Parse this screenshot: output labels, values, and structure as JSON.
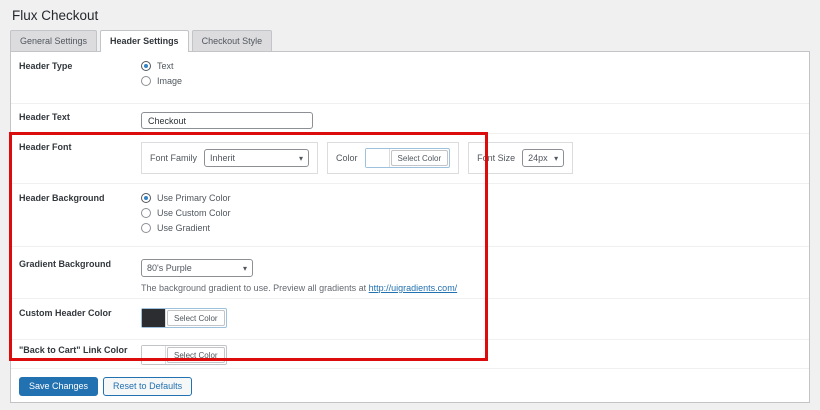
{
  "page": {
    "title": "Flux Checkout"
  },
  "tabs": [
    {
      "label": "General Settings",
      "active": false
    },
    {
      "label": "Header Settings",
      "active": true
    },
    {
      "label": "Checkout Style",
      "active": false
    }
  ],
  "icons": {
    "chevron_down": "▾"
  },
  "rows": {
    "header_type": {
      "label": "Header Type",
      "options": [
        {
          "label": "Text",
          "selected": true
        },
        {
          "label": "Image",
          "selected": false
        }
      ]
    },
    "header_text": {
      "label": "Header Text",
      "value": "Checkout"
    },
    "header_font": {
      "label": "Header Font",
      "font_family_label": "Font Family",
      "font_family_value": "Inherit",
      "color_label": "Color",
      "color_swatch": "#ffffff",
      "color_button": "Select Color",
      "font_size_label": "Font Size",
      "font_size_value": "24px"
    },
    "header_background": {
      "label": "Header Background",
      "options": [
        {
          "label": "Use Primary Color",
          "selected": true
        },
        {
          "label": "Use Custom Color",
          "selected": false
        },
        {
          "label": "Use Gradient",
          "selected": false
        }
      ]
    },
    "gradient_background": {
      "label": "Gradient Background",
      "value": "80's Purple",
      "description": "The background gradient to use. Preview all gradients at ",
      "link": "http://uigradients.com/"
    },
    "custom_header_color": {
      "label": "Custom Header Color",
      "swatch": "#2b2d31",
      "button": "Select Color"
    },
    "back_to_cart_link_color": {
      "label": "\"Back to Cart\" Link Color",
      "swatch": "#ffffff",
      "button": "Select Color"
    }
  },
  "footer": {
    "save_label": "Save Changes",
    "reset_label": "Reset to Defaults"
  },
  "colors": {
    "accent": "#2271b1",
    "highlight": "#dc0c0c",
    "page_background": "#f0f0f1"
  }
}
